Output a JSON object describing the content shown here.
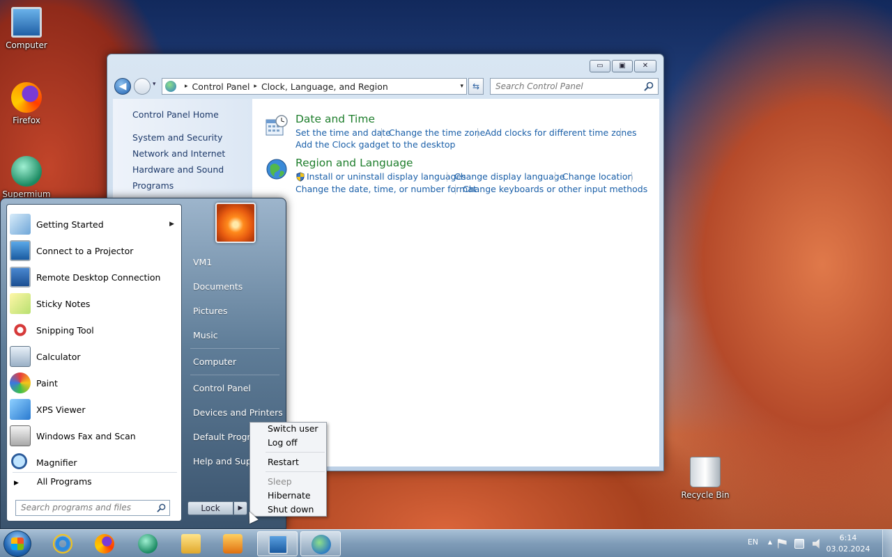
{
  "desktop": {
    "icons": [
      {
        "label": "Computer",
        "icon": "computer-icon"
      },
      {
        "label": "Firefox",
        "icon": "firefox-icon"
      },
      {
        "label": "Supermium",
        "icon": "supermium-icon"
      },
      {
        "label": "Recycle Bin",
        "icon": "recycle-bin-icon"
      }
    ]
  },
  "control_panel": {
    "window_controls": {
      "minimize": "▭",
      "maximize": "▣",
      "close": "✕"
    },
    "address": {
      "crumbs": [
        "Control Panel",
        "Clock, Language, and Region"
      ],
      "separator": "▸",
      "dropdown": "▾"
    },
    "refresh_symbol": "⇆",
    "search_placeholder": "Search Control Panel",
    "left_nav": {
      "home": "Control Panel Home",
      "links": [
        "System and Security",
        "Network and Internet",
        "Hardware and Sound",
        "Programs"
      ]
    },
    "categories": [
      {
        "title": "Date and Time",
        "icon": "clock-calendar-icon",
        "links": [
          "Set the time and date",
          "Change the time zone",
          "Add clocks for different time zones",
          "Add the Clock gadget to the desktop"
        ]
      },
      {
        "title": "Region and Language",
        "icon": "globe-icon",
        "links": [
          "Install or uninstall display languages",
          "Change display language",
          "Change location",
          "Change the date, time, or number format",
          "Change keyboards or other input methods"
        ]
      }
    ],
    "colors": {
      "category_title": "#1e7e2c",
      "link": "#1a5fa8"
    }
  },
  "start_menu": {
    "programs": [
      {
        "label": "Getting Started",
        "icon": "getting-started-icon",
        "has_submenu": true
      },
      {
        "label": "Connect to a Projector",
        "icon": "projector-icon",
        "has_submenu": false
      },
      {
        "label": "Remote Desktop Connection",
        "icon": "remote-desktop-icon",
        "has_submenu": false
      },
      {
        "label": "Sticky Notes",
        "icon": "sticky-notes-icon",
        "has_submenu": false
      },
      {
        "label": "Snipping Tool",
        "icon": "snipping-tool-icon",
        "has_submenu": false
      },
      {
        "label": "Calculator",
        "icon": "calculator-icon",
        "has_submenu": false
      },
      {
        "label": "Paint",
        "icon": "paint-icon",
        "has_submenu": false
      },
      {
        "label": "XPS Viewer",
        "icon": "xps-viewer-icon",
        "has_submenu": false
      },
      {
        "label": "Windows Fax and Scan",
        "icon": "fax-scan-icon",
        "has_submenu": false
      },
      {
        "label": "Magnifier",
        "icon": "magnifier-icon",
        "has_submenu": false
      }
    ],
    "submenu_arrow": "▶",
    "all_programs": "All Programs",
    "all_programs_arrow": "▶",
    "search_placeholder": "Search programs and files",
    "right_items": [
      "VM1",
      "Documents",
      "Pictures",
      "Music",
      "Computer",
      "Control Panel",
      "Devices and Printers",
      "Default Programs",
      "Help and Support"
    ],
    "lock_label": "Lock",
    "lock_arrow": "▶"
  },
  "power_menu": {
    "items": [
      {
        "label": "Switch user",
        "enabled": true
      },
      {
        "label": "Log off",
        "enabled": true
      },
      {
        "label": "Restart",
        "enabled": true
      },
      {
        "label": "Sleep",
        "enabled": false
      },
      {
        "label": "Hibernate",
        "enabled": true
      },
      {
        "label": "Shut down",
        "enabled": true
      }
    ]
  },
  "taskbar": {
    "pinned": [
      {
        "app": "Internet Explorer",
        "icon": "internet-explorer-icon",
        "active": false
      },
      {
        "app": "Firefox",
        "icon": "firefox-icon",
        "active": false
      },
      {
        "app": "Supermium",
        "icon": "supermium-icon",
        "active": false
      },
      {
        "app": "File Explorer",
        "icon": "folder-icon",
        "active": false
      },
      {
        "app": "Media Player",
        "icon": "media-player-icon",
        "active": false
      },
      {
        "app": "Remote Desktop",
        "icon": "remote-desktop-icon",
        "active": true
      },
      {
        "app": "Control Panel",
        "icon": "control-panel-icon",
        "active": true
      }
    ],
    "tray": {
      "language": "EN",
      "show_hidden": "▲",
      "icons": [
        "action-center-flag-icon",
        "network-icon",
        "volume-muted-icon"
      ],
      "time": "6:14",
      "date": "03.02.2024"
    }
  }
}
